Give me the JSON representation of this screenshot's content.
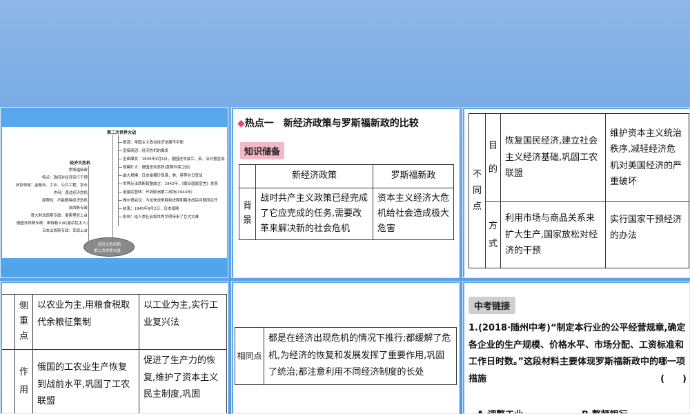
{
  "slide1": {
    "title": "第二次世界大战",
    "branches": [
      "根源：帝国主义政治经济发展不平衡",
      "直接原因：经济危机的爆发",
      "全面爆发：1939年9月1日，德国进攻波兰，英、法对德宣战",
      "规模扩大：德国进攻苏联(莫斯科保卫战)",
      "最大规模：日本偷袭珍珠港，美、英等对日宣战",
      "世界反法西斯联盟成立：1942年，《联合国家宣言》发表",
      "诺曼底登陆：开辟欧洲第二战场(1944年)",
      "雅尔塔会议：为加快战争胜利进程和解决战后问题而召开",
      "结束：1945年9月2日，日本投降",
      "影响：给人类社会和世界文明带来了巨大灾难"
    ],
    "left_title": "经济大危机",
    "left_items": [
      "罗斯福新政",
      "特点：政府对经济实行干预",
      "涉及领域：金融业、工业、公共工程、农业",
      "作用：渡过经济危机",
      "局限性：不能根除经济危机",
      "法西斯专政",
      "意大利法西斯专政：墨索里尼上台",
      "德国法西斯专政：希特勒上台(激杀犹太人)",
      "日本法西斯专政：军部上台"
    ],
    "center_label_1": "经济大危机和",
    "center_label_2": "第二次世界大战"
  },
  "slide2": {
    "heading": "热点一　新经济政策与罗斯福新政的比较",
    "badge": "知识储备",
    "col1": "新经济政策",
    "col2": "罗斯福新政",
    "row_label": "背景",
    "cell1": "战时共产主义政策已经完成了它应完成的任务,需要改革来解决新的社会危机",
    "cell2": "资本主义经济大危机给社会造成极大危害"
  },
  "slide3": {
    "outer_label": "不同点",
    "row1_label": "目的",
    "row1_c1": "恢复国民经济,建立社会主义经济基础,巩固工农联盟",
    "row1_c2": "维护资本主义统治秩序,减轻经济危机对美国经济的严重破坏",
    "row2_label": "方式",
    "row2_c1": "利用市场与商品关系来扩大生产,国家放松对经济的干预",
    "row2_c2": "实行国家干预经济的办法"
  },
  "slide4": {
    "row1_label": "侧重点",
    "row1_c1": "以农业为主,用粮食税取代余粮征集制",
    "row1_c2": "以工业为主,实行工业复兴法",
    "row2_label": "作用",
    "row2_c1": "俄国的工农业生产恢复到战前水平,巩固了工农联盟",
    "row2_c2": "促进了生产力的恢复,维护了资本主义民主制度,巩固"
  },
  "slide5": {
    "label": "相同点",
    "text": "都是在经济出现危机的情况下推行;都缓解了危机,为经济的恢复和发展发挥了重要作用,巩固了统治;都注意利用不同经济制度的长处"
  },
  "slide6": {
    "badge": "中考链接",
    "question": "1.(2018·随州中考)“制定本行业的公平经营规章,确定各企业的生产规模、价格水平、市场分配、工资标准和工作日时数。”这段材料主要体现罗斯福新政中的哪一项措施",
    "bracket": "(　　)",
    "optA": "A.调整工业",
    "optB": "B.整顿银行"
  }
}
